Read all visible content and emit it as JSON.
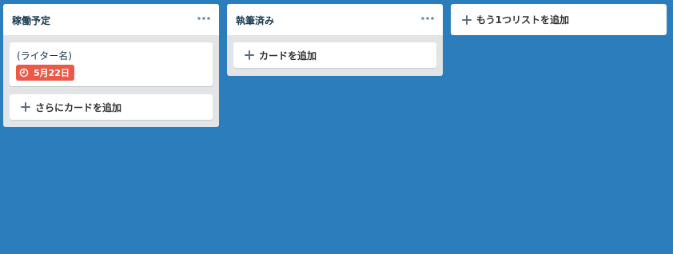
{
  "lists": [
    {
      "title": "稼働予定",
      "cards": [
        {
          "title": "(ライター名)",
          "due": "5月22日"
        }
      ],
      "add_card_label": "さらにカードを追加"
    },
    {
      "title": "執筆済み",
      "cards": [],
      "add_card_label": "カードを追加"
    }
  ],
  "add_list_label": "もう1つリストを追加",
  "colors": {
    "board_background": "#2c7dbb",
    "list_background": "#e2e4e6",
    "due_badge": "#eb5a46"
  },
  "icons": {
    "menu": "more-horizontal-icon",
    "add": "plus-icon",
    "due": "clock-icon"
  }
}
